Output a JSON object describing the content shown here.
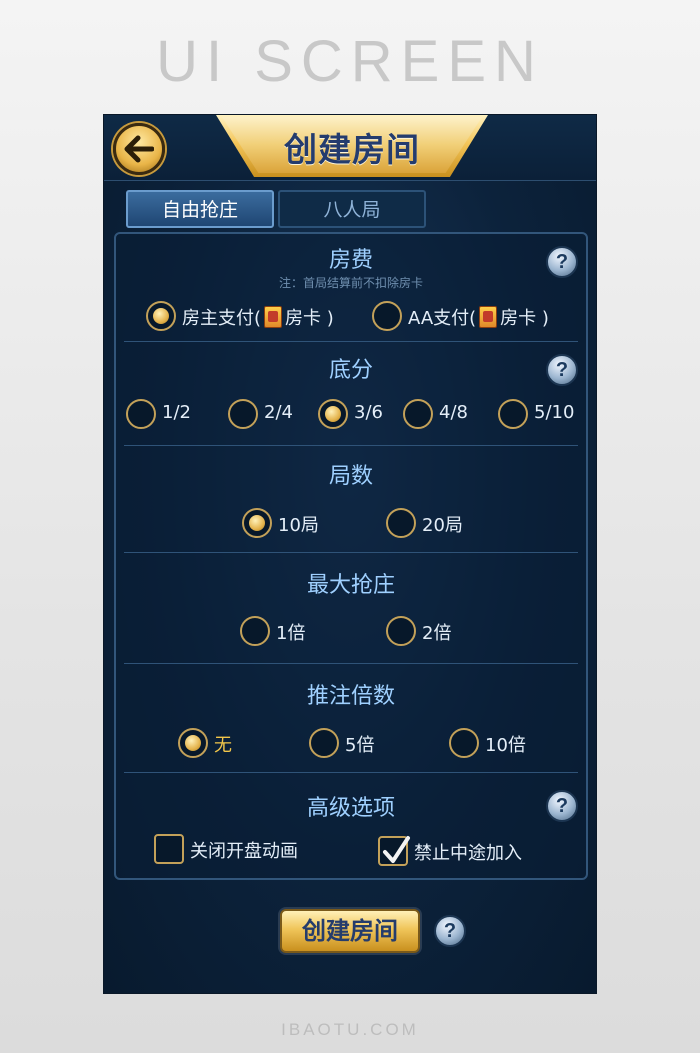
{
  "banner": {
    "title": "UI SCREEN",
    "footer": "IBAOTU.COM"
  },
  "header": {
    "title": "创建房间",
    "back_icon": "arrow-left-icon"
  },
  "tabs": [
    {
      "label": "自由抢庄",
      "active": true
    },
    {
      "label": "八人局",
      "active": false
    }
  ],
  "sections": {
    "room_fee": {
      "title": "房费",
      "note": "注：首局结算前不扣除房卡",
      "options": [
        {
          "prefix": "房主支付(",
          "suffix": "房卡 )",
          "selected": true
        },
        {
          "prefix": "AA支付(",
          "suffix": "房卡 )",
          "selected": false
        }
      ]
    },
    "base_score": {
      "title": "底分",
      "options": [
        {
          "label": "1/2",
          "selected": false
        },
        {
          "label": "2/4",
          "selected": false
        },
        {
          "label": "3/6",
          "selected": true
        },
        {
          "label": "4/8",
          "selected": false
        },
        {
          "label": "5/10",
          "selected": false
        }
      ]
    },
    "rounds": {
      "title": "局数",
      "options": [
        {
          "label": "10局",
          "selected": true
        },
        {
          "label": "20局",
          "selected": false
        }
      ]
    },
    "max_banker": {
      "title": "最大抢庄",
      "options": [
        {
          "label": "1倍",
          "selected": false
        },
        {
          "label": "2倍",
          "selected": false
        }
      ]
    },
    "bet_multiplier": {
      "title": "推注倍数",
      "options": [
        {
          "label": "无",
          "selected": true
        },
        {
          "label": "5倍",
          "selected": false
        },
        {
          "label": "10倍",
          "selected": false
        }
      ]
    },
    "advanced": {
      "title": "高级选项",
      "options": [
        {
          "label": "关闭开盘动画",
          "checked": false
        },
        {
          "label": "禁止中途加入",
          "checked": true
        }
      ]
    }
  },
  "help_glyph": "?",
  "create_button": {
    "label": "创建房间"
  },
  "colors": {
    "gold": "#f2c64a",
    "title_blue": "#9fd0ff",
    "panel_bg": "#0c223b"
  }
}
